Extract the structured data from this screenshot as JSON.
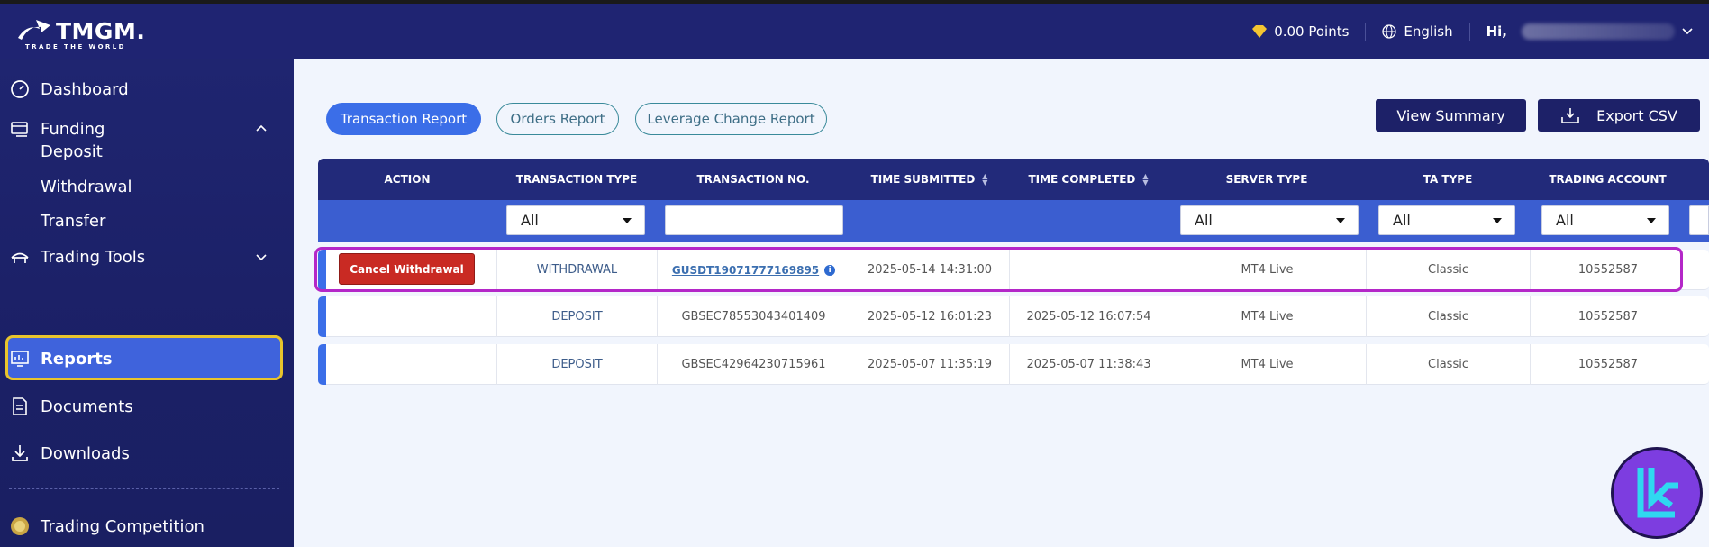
{
  "header": {
    "logo_text": "TMGM.",
    "logo_tagline": "TRADE THE WORLD",
    "points": "0.00 Points",
    "language": "English",
    "greeting": "Hi,"
  },
  "sidebar": {
    "items": [
      {
        "label": "Dashboard",
        "icon": "dashboard-icon"
      },
      {
        "label": "Funding",
        "icon": "funding-icon",
        "expanded": true
      },
      {
        "label": "Deposit"
      },
      {
        "label": "Withdrawal"
      },
      {
        "label": "Transfer"
      },
      {
        "label": "Trading Tools",
        "icon": "trading-tools-icon",
        "expanded": false
      },
      {
        "label": "Reports",
        "icon": "reports-icon",
        "active": true
      },
      {
        "label": "Documents",
        "icon": "documents-icon"
      },
      {
        "label": "Downloads",
        "icon": "downloads-icon"
      },
      {
        "label": "Trading Competition",
        "icon": "trophy-icon"
      }
    ]
  },
  "main": {
    "tabs": [
      {
        "label": "Transaction Report",
        "active": true
      },
      {
        "label": "Orders Report",
        "active": false
      },
      {
        "label": "Leverage Change Report",
        "active": false
      }
    ],
    "view_summary": "View Summary",
    "export_csv": "Export CSV",
    "columns": [
      "ACTION",
      "TRANSACTION TYPE",
      "TRANSACTION NO.",
      "TIME SUBMITTED",
      "TIME COMPLETED",
      "SERVER TYPE",
      "TA TYPE",
      "TRADING ACCOUNT"
    ],
    "filters": {
      "transaction_type": "All",
      "transaction_no": "",
      "server_type": "All",
      "ta_type": "All",
      "trading_account": "All"
    },
    "rows": [
      {
        "action": "Cancel Withdrawal",
        "type": "WITHDRAWAL",
        "no": "GUSDT19071777169895",
        "submitted": "2025-05-14 14:31:00",
        "completed": "",
        "server": "MT4 Live",
        "ta_type": "Classic",
        "account": "10552587"
      },
      {
        "action": "",
        "type": "DEPOSIT",
        "no": "GBSEC78553043401409",
        "submitted": "2025-05-12 16:01:23",
        "completed": "2025-05-12 16:07:54",
        "server": "MT4 Live",
        "ta_type": "Classic",
        "account": "10552587"
      },
      {
        "action": "",
        "type": "DEPOSIT",
        "no": "GBSEC42964230715961",
        "submitted": "2025-05-07 11:35:19",
        "completed": "2025-05-07 11:38:43",
        "server": "MT4 Live",
        "ta_type": "Classic",
        "account": "10552587"
      }
    ]
  },
  "colors": {
    "navy": "#1f2472",
    "accent_blue": "#3b6ee8",
    "cancel_red": "#c92a23",
    "highlight_purple": "#b427c8",
    "highlight_yellow": "#e8c42c"
  }
}
